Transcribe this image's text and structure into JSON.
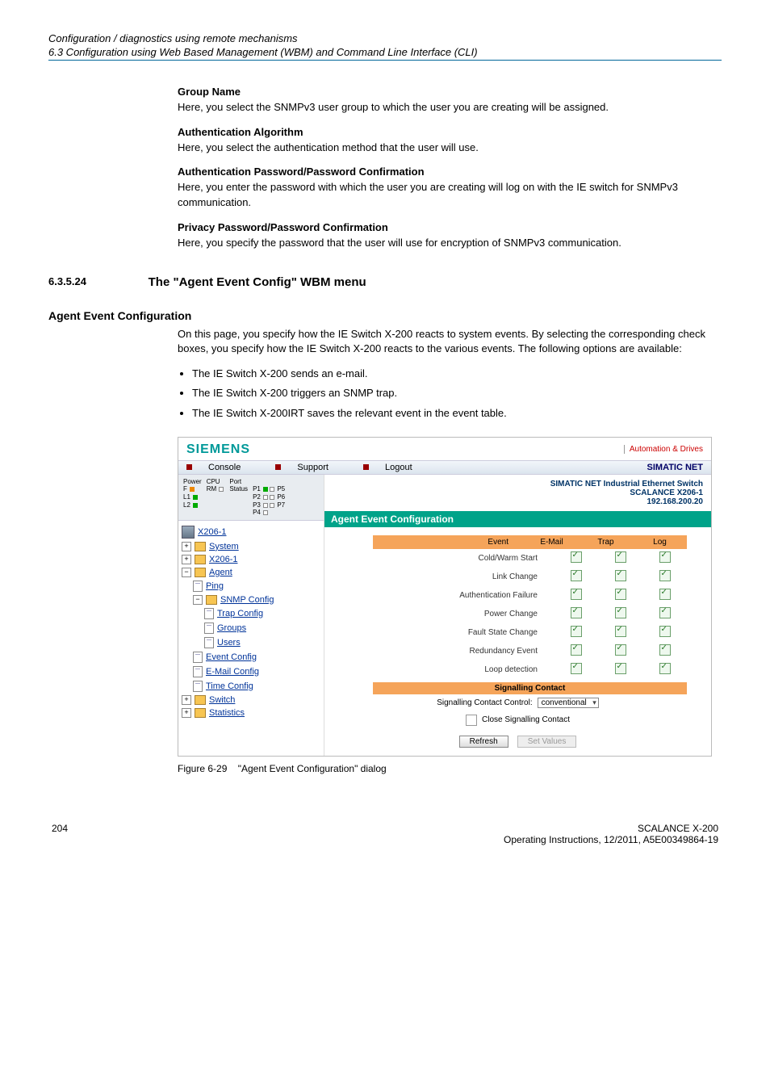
{
  "breadcrumb": {
    "title": "Configuration / diagnostics using remote mechanisms",
    "sub": "6.3 Configuration using Web Based Management (WBM) and Command Line Interface (CLI)"
  },
  "groupName": {
    "head": "Group Name",
    "body": "Here, you select the SNMPv3 user group to which the user you are creating will be assigned."
  },
  "authAlg": {
    "head": "Authentication Algorithm",
    "body": "Here, you select the authentication method that the user will use."
  },
  "authPw": {
    "head": "Authentication Password/Password Confirmation",
    "body": "Here, you enter the password with which the user you are creating will log on with the IE switch for SNMPv3 communication."
  },
  "privPw": {
    "head": "Privacy Password/Password Confirmation",
    "body": "Here, you specify the password that the user will use for encryption of SNMPv3 communication."
  },
  "section": {
    "num": "6.3.5.24",
    "title": "The \"Agent Event Config\" WBM menu"
  },
  "aec": {
    "head": "Agent Event Configuration",
    "intro": "On this page, you specify how the IE Switch X-200 reacts to system events. By selecting the corresponding check boxes, you specify how the IE Switch X-200 reacts to the various events. The following options are available:",
    "bullets": [
      "The IE Switch X-200 sends an e-mail.",
      "The IE Switch X-200 triggers an SNMP trap.",
      "The IE Switch X-200IRT saves the relevant event in the event table."
    ]
  },
  "shot": {
    "brand": "SIEMENS",
    "tagline": "Automation & Drives",
    "nav": {
      "console": "Console",
      "support": "Support",
      "logout": "Logout"
    },
    "simatic": "SIMATIC NET",
    "statusLabels": {
      "power": "Power",
      "cpu": "CPU",
      "port": "Port",
      "status": "Status",
      "f": "F",
      "l1": "L1",
      "l2": "L2",
      "rm": "RM",
      "p1": "P1",
      "p2": "P2",
      "p3": "P3",
      "p4": "P4",
      "p5": "P5",
      "p6": "P6",
      "p7": "P7"
    },
    "rightHeader": {
      "l1": "SIMATIC NET Industrial Ethernet Switch",
      "l2": "SCALANCE X206-1",
      "l3": "192.168.200.20"
    },
    "greenbar": "Agent Event Configuration",
    "tree": {
      "root": "X206-1",
      "system": "System",
      "x206": "X206-1",
      "agent": "Agent",
      "ping": "Ping",
      "snmp": "SNMP Config",
      "trap": "Trap Config",
      "groups": "Groups",
      "users": "Users",
      "event": "Event Config",
      "email": "E-Mail Config",
      "time": "Time Config",
      "switch": "Switch",
      "stats": "Statistics"
    },
    "cols": {
      "event": "Event",
      "email": "E-Mail",
      "trap": "Trap",
      "log": "Log"
    },
    "rows": [
      "Cold/Warm Start",
      "Link Change",
      "Authentication Failure",
      "Power Change",
      "Fault State Change",
      "Redundancy Event",
      "Loop detection"
    ],
    "sigHeader": "Signalling Contact",
    "sigLabel": "Signalling Contact Control:",
    "sigValue": "conventional",
    "closeSig": "Close Signalling Contact",
    "refresh": "Refresh",
    "setValues": "Set Values"
  },
  "caption": {
    "label": "Figure 6-29",
    "text": "\"Agent Event Configuration\" dialog"
  },
  "footer": {
    "pagenum": "204",
    "r1": "SCALANCE X-200",
    "r2": "Operating Instructions, 12/2011, A5E00349864-19"
  }
}
